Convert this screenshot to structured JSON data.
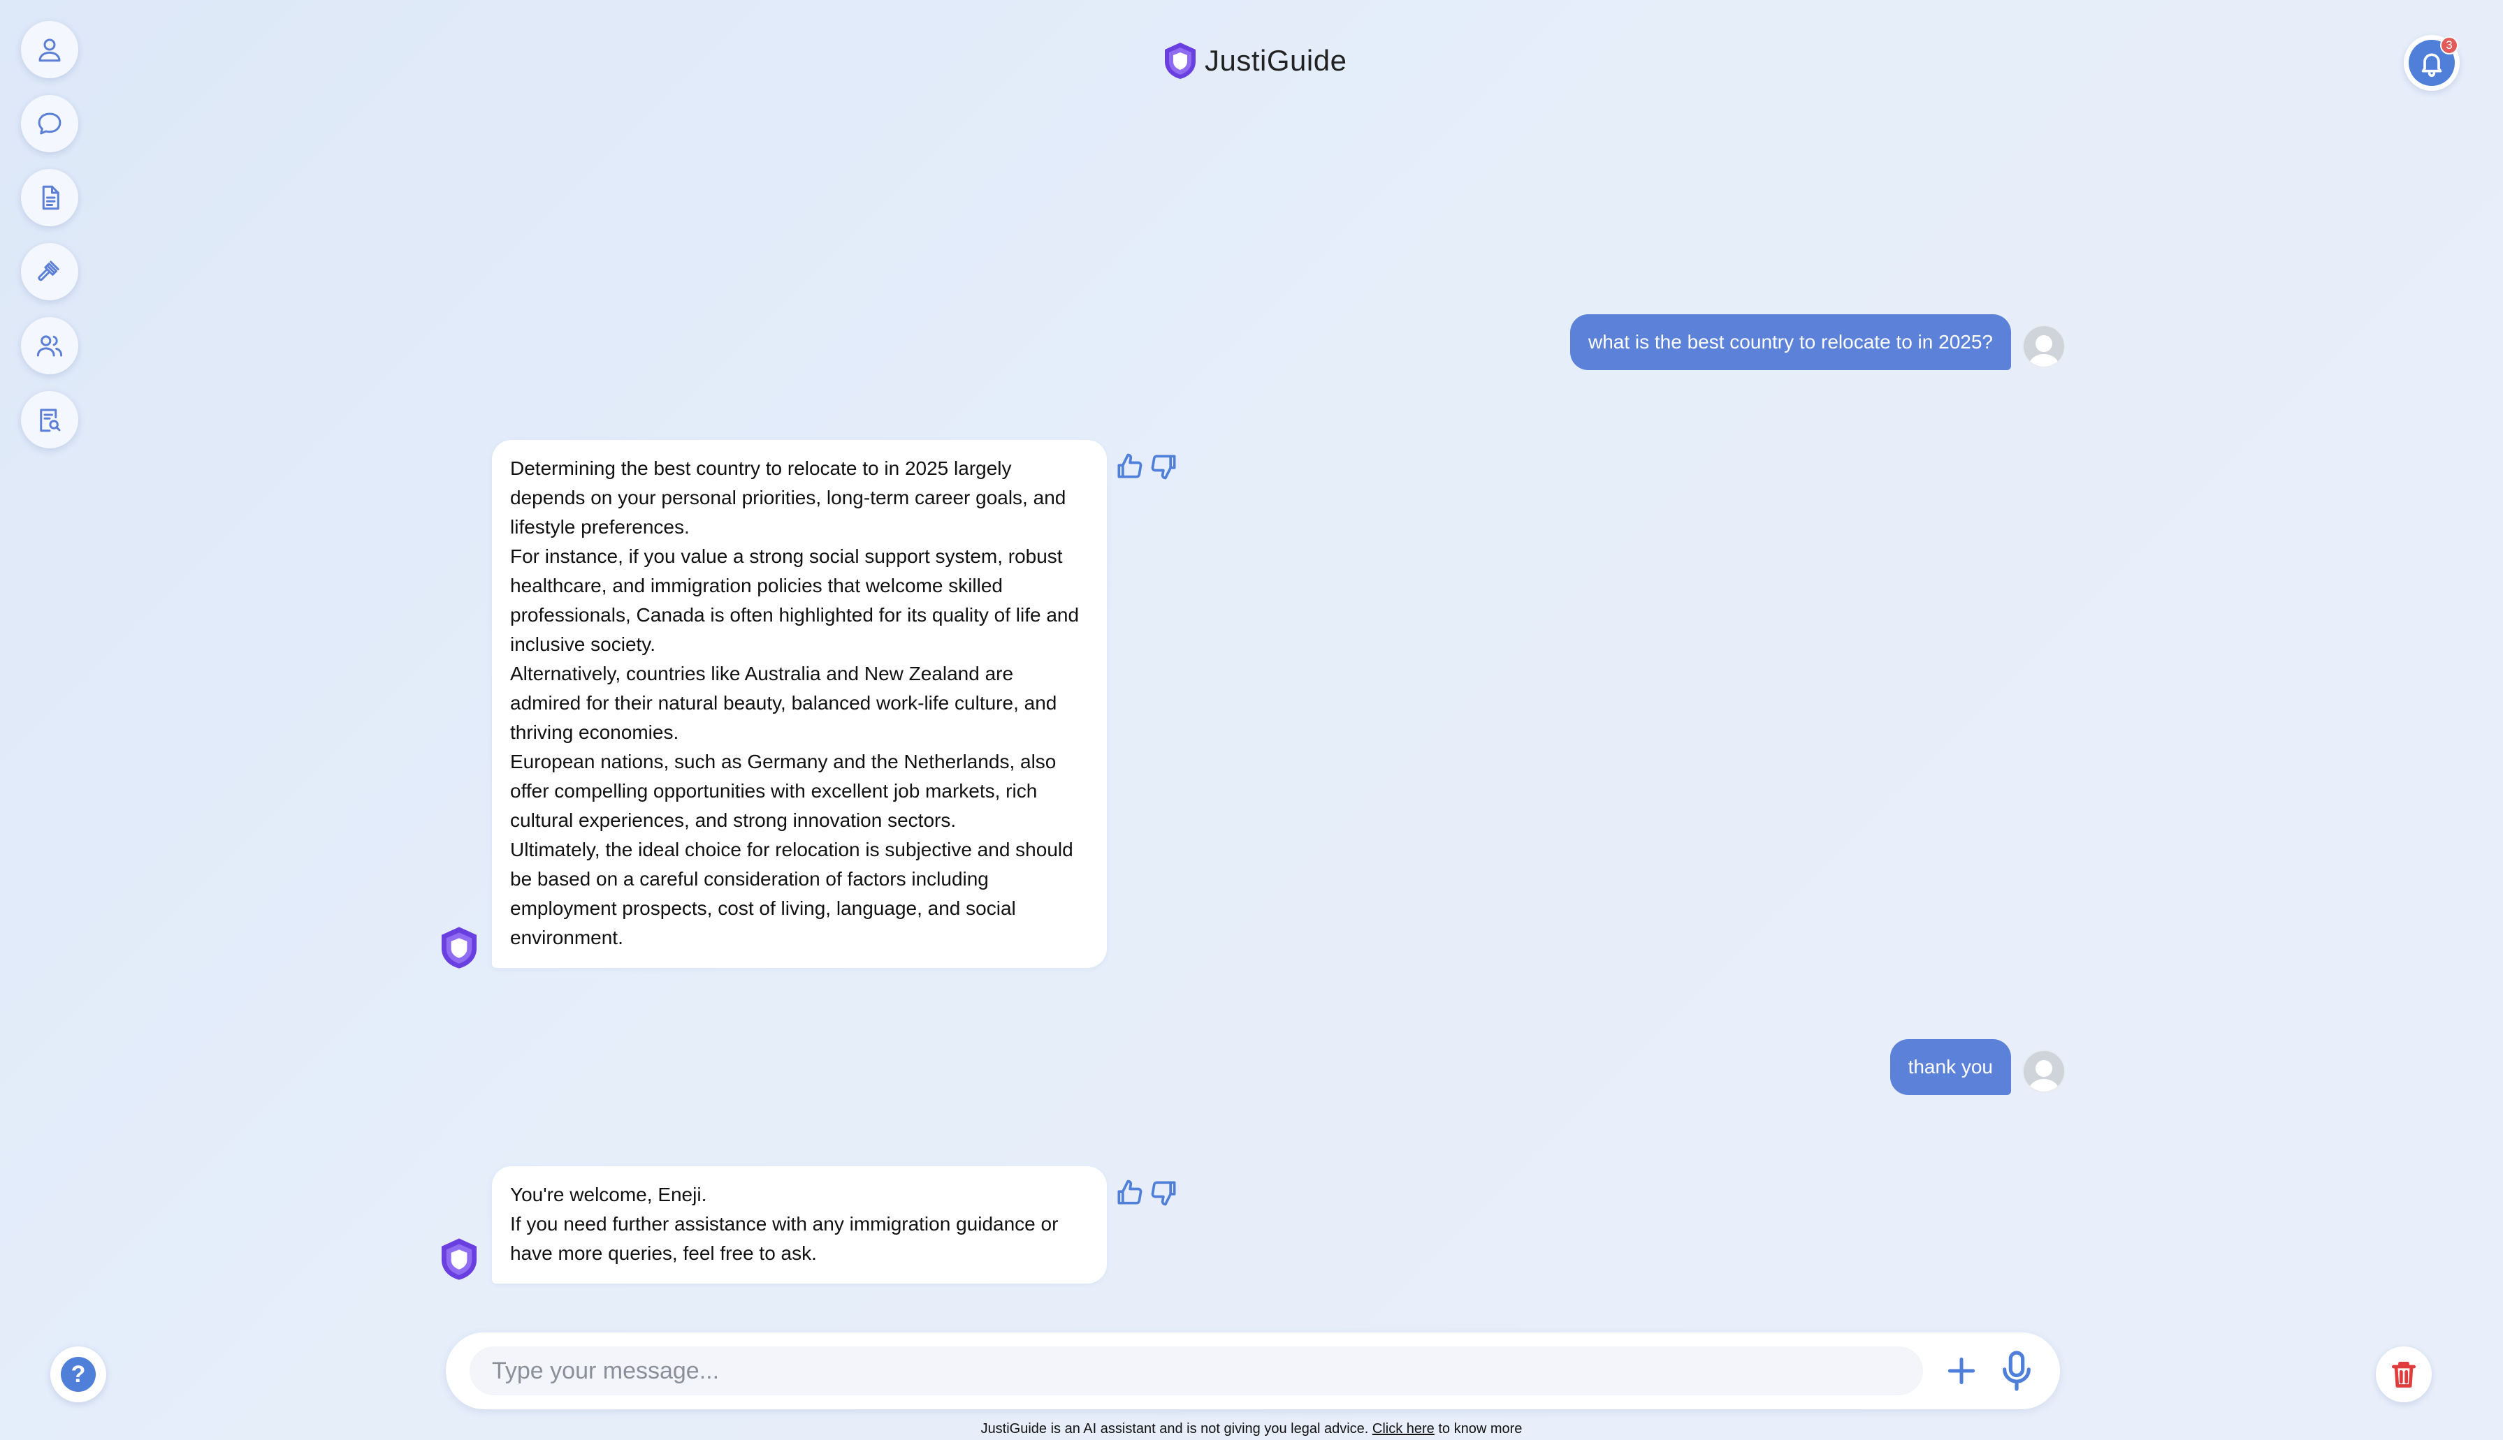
{
  "app": {
    "title": "JustiGuide",
    "notification_count": "3"
  },
  "sidebar": {
    "items": [
      {
        "icon": "user-icon"
      },
      {
        "icon": "chat-bubble-icon"
      },
      {
        "icon": "document-icon"
      },
      {
        "icon": "gavel-icon"
      },
      {
        "icon": "users-icon"
      },
      {
        "icon": "document-search-icon"
      }
    ]
  },
  "conversation": {
    "messages": [
      {
        "role": "user",
        "text": "what is the best country to relocate to in 2025?"
      },
      {
        "role": "assistant",
        "paragraphs": [
          "Determining the best country to relocate to in 2025 largely depends on your personal priorities, long-term career goals, and lifestyle preferences.",
          "For instance, if you value a strong social support system, robust healthcare, and immigration policies that welcome skilled professionals, Canada is often highlighted for its quality of life and inclusive society.",
          "Alternatively, countries like Australia and New Zealand are admired for their natural beauty, balanced work-life culture, and thriving economies.",
          "European nations, such as Germany and the Netherlands, also offer compelling opportunities with excellent job markets, rich cultural experiences, and strong innovation sectors.",
          "Ultimately, the ideal choice for relocation is subjective and should be based on a careful consideration of factors including employment prospects, cost of living, language, and social environment."
        ]
      },
      {
        "role": "user",
        "text": "thank you"
      },
      {
        "role": "assistant",
        "paragraphs": [
          "You're welcome, Eneji.",
          "If you need further assistance with any immigration guidance or have more queries, feel free to ask."
        ]
      }
    ]
  },
  "composer": {
    "placeholder": "Type your message..."
  },
  "footer": {
    "disclaimer_prefix": "JustiGuide is an AI assistant and is not giving you legal advice.",
    "link_text": "Click here",
    "disclaimer_suffix": "to know more"
  },
  "colors": {
    "accent": "#4f7fd8",
    "user_bubble": "#5b82d8",
    "brand_purple": "#6a3fe0",
    "danger": "#e03c3c",
    "badge": "#e35a5a"
  }
}
